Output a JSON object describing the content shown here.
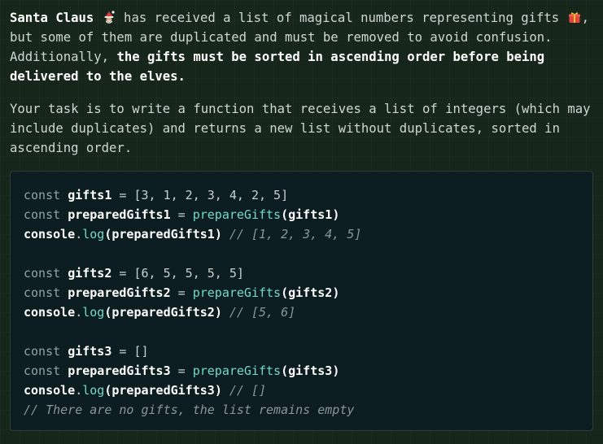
{
  "intro": {
    "p1_name": "Santa Claus",
    "p1_a": " has received a list of magical numbers representing gifts",
    "p1_b": ", but some of them are duplicated and must be removed to avoid confusion. Additionally, ",
    "p1_bold": "the gifts must be sorted in ascending order before being delivered to the elves.",
    "p2": "Your task is to write a function that receives a list of integers (which may include duplicates) and returns a new list without duplicates, sorted in ascending order."
  },
  "emojis": {
    "santa": "santa-emoji-icon",
    "gift": "gift-emoji-icon"
  },
  "code": {
    "kw_const": "const",
    "fn_name": "prepareGifts",
    "console": "console",
    "log": "log",
    "blocks": [
      {
        "var": "gifts1",
        "value": "[3, 1, 2, 3, 4, 2, 5]",
        "prepared": "preparedGifts1",
        "result_comment": "// [1, 2, 3, 4, 5]"
      },
      {
        "var": "gifts2",
        "value": "[6, 5, 5, 5, 5]",
        "prepared": "preparedGifts2",
        "result_comment": "// [5, 6]"
      },
      {
        "var": "gifts3",
        "value": "[]",
        "prepared": "preparedGifts3",
        "result_comment": "// []"
      }
    ],
    "final_comment": "// There are no gifts, the list remains empty"
  },
  "colors": {
    "background": "#17261b",
    "code_background": "#0c1d22",
    "function_color": "#73d9c8",
    "keyword_color": "#8ea4a8",
    "comment_color": "#8a9699"
  }
}
